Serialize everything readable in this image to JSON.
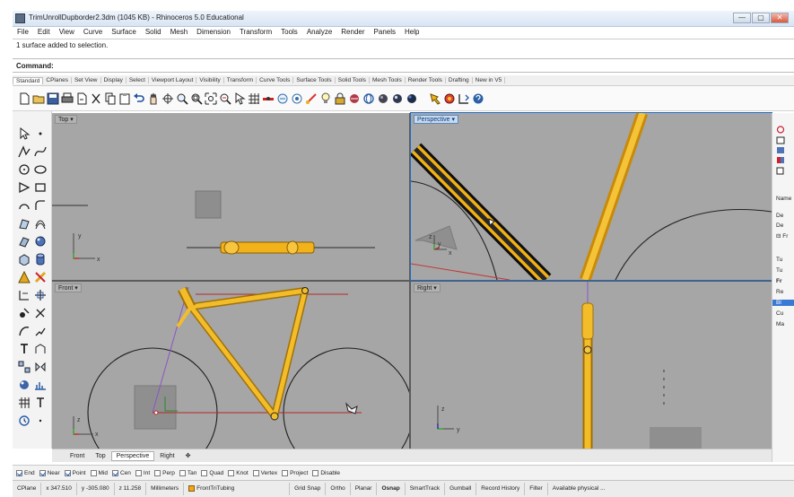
{
  "window": {
    "title": "TrimUnrollDupborder2.3dm (1045 KB) - Rhinoceros 5.0 Educational",
    "controls": [
      "—",
      "▢",
      "✕"
    ]
  },
  "menu": [
    "File",
    "Edit",
    "View",
    "Curve",
    "Surface",
    "Solid",
    "Mesh",
    "Dimension",
    "Transform",
    "Tools",
    "Analyze",
    "Render",
    "Panels",
    "Help"
  ],
  "command": {
    "history": "1 surface added to selection.",
    "prompt": "Command:",
    "value": ""
  },
  "toolbar_tabs": [
    "Standard",
    "CPlanes",
    "Set View",
    "Display",
    "Select",
    "Viewport Layout",
    "Visibility",
    "Transform",
    "Curve Tools",
    "Surface Tools",
    "Solid Tools",
    "Mesh Tools",
    "Render Tools",
    "Drafting",
    "New in V5"
  ],
  "viewports": {
    "top": {
      "label": "Top"
    },
    "perspective": {
      "label": "Perspective"
    },
    "front": {
      "label": "Front"
    },
    "right": {
      "label": "Right"
    },
    "axis_x": "x",
    "axis_y": "y",
    "axis_z": "z"
  },
  "viewport_tabs": [
    "Front",
    "Top",
    "Perspective",
    "Right",
    "✥"
  ],
  "right_panel": {
    "name_header": "Name",
    "layers": [
      "De",
      "De",
      "⊟ Fr",
      "Tu",
      "Tu",
      "Fr",
      "Re",
      "Bl",
      "Cu",
      "Ma"
    ],
    "selected_index": 7
  },
  "osnaps": [
    {
      "label": "End",
      "on": true
    },
    {
      "label": "Near",
      "on": true
    },
    {
      "label": "Point",
      "on": true
    },
    {
      "label": "Mid",
      "on": false
    },
    {
      "label": "Cen",
      "on": true
    },
    {
      "label": "Int",
      "on": false
    },
    {
      "label": "Perp",
      "on": false
    },
    {
      "label": "Tan",
      "on": false
    },
    {
      "label": "Quad",
      "on": false
    },
    {
      "label": "Knot",
      "on": false
    },
    {
      "label": "Vertex",
      "on": false
    },
    {
      "label": "Project",
      "on": false
    },
    {
      "label": "Disable",
      "on": false
    }
  ],
  "status": {
    "cplane": "CPlane",
    "x": "x 347.510",
    "y": "y -305.080",
    "z": "z 11.258",
    "units": "Millimeters",
    "layer": "FrontTriTubing",
    "layer_color": "#f2a81d",
    "toggles": [
      "Grid Snap",
      "Ortho",
      "Planar",
      "Osnap",
      "SmartTrack",
      "Gumball",
      "Record History",
      "Filter"
    ],
    "active_toggle": "Osnap",
    "message": "Available physical ..."
  },
  "colors": {
    "viewport_bg": "#a6a6a6",
    "tube": "#f2b21a",
    "active_blue": "#1f6cc7"
  }
}
